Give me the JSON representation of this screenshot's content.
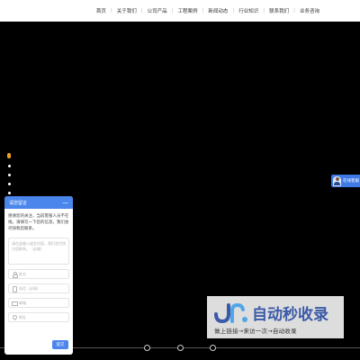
{
  "nav": {
    "items": [
      "首页",
      "关于我们",
      "公司产品",
      "工程案例",
      "新闻动态",
      "行业知识",
      "联系我们",
      "业务咨询"
    ]
  },
  "float_consult": {
    "label": "在线客服"
  },
  "chat": {
    "title": "请您留言",
    "minimize": "—",
    "message": "感谢您的关注，当前客服人员不在线，请填写一下您的信息，我们会尽快和您联系。",
    "textarea_placeholder": "请在此输入留言内容，我们会尽快与您联系。（必填）",
    "fields": [
      {
        "icon": "user-icon",
        "placeholder": "姓名"
      },
      {
        "icon": "phone-icon",
        "placeholder": "电话（必填）"
      },
      {
        "icon": "mail-icon",
        "placeholder": "邮箱"
      },
      {
        "icon": "location-icon",
        "placeholder": "地址"
      }
    ],
    "submit": "提交"
  },
  "watermark": {
    "title": "自动秒收录",
    "subtitle": "做上链接→来访一次→自动收录"
  },
  "colors": {
    "accent": "#4a86ec",
    "slider_active": "#f0a020",
    "watermark_text": "#3a5aa8"
  }
}
